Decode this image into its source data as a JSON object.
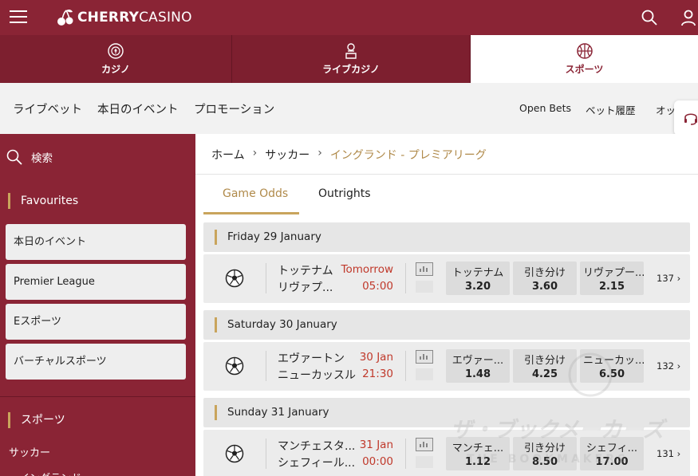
{
  "brand": {
    "logo_text_bold": "CHERRY",
    "logo_text_rest": "CASINO",
    "accent": "#8a2435",
    "gold": "#c9a45c"
  },
  "categories": [
    {
      "label": "カジノ",
      "icon": "casino-chip-icon"
    },
    {
      "label": "ライブカジノ",
      "icon": "live-dealer-icon"
    },
    {
      "label": "スポーツ",
      "icon": "basketball-icon",
      "active": true
    }
  ],
  "subnav": {
    "items": [
      "ライブベット",
      "本日のイベント",
      "プロモーション"
    ],
    "right": [
      "Open Bets",
      "ベット履歴",
      "オッ"
    ]
  },
  "sidebar": {
    "search_label": "検索",
    "favourites_heading": "Favourites",
    "favourites": [
      "本日のイベント",
      "Premier League",
      "Eスポーツ",
      "バーチャルスポーツ"
    ],
    "sports_heading": "スポーツ",
    "sports": [
      "サッカー",
      "イングランド"
    ]
  },
  "breadcrumb": {
    "home": "ホーム",
    "sport": "サッカー",
    "current": "イングランド - プレミアリーグ"
  },
  "odds_tabs": [
    {
      "label": "Game Odds",
      "active": true
    },
    {
      "label": "Outrights",
      "active": false
    }
  ],
  "days": [
    {
      "date": "Friday 29 January",
      "match": {
        "home": "トッテナム",
        "away": "リヴァプ...",
        "time1": "Tomorrow",
        "time2": "05:00",
        "odds": [
          {
            "label": "トッテナム",
            "value": "3.20"
          },
          {
            "label": "引き分け",
            "value": "3.60"
          },
          {
            "label": "リヴァプー...",
            "value": "2.15"
          }
        ],
        "more": "137"
      }
    },
    {
      "date": "Saturday 30 January",
      "match": {
        "home": "エヴァートン",
        "away": "ニューカッスル",
        "time1": "30 Jan",
        "time2": "21:30",
        "odds": [
          {
            "label": "エヴァー...",
            "value": "1.48"
          },
          {
            "label": "引き分け",
            "value": "4.25"
          },
          {
            "label": "ニューカッ...",
            "value": "6.50"
          }
        ],
        "more": "132"
      }
    },
    {
      "date": "Sunday 31 January",
      "match": {
        "home": "マンチェスタ...",
        "away": "シェフィール...",
        "time1": "31 Jan",
        "time2": "00:00",
        "odds": [
          {
            "label": "マンチェ...",
            "value": "1.12"
          },
          {
            "label": "引き分け",
            "value": "8.50"
          },
          {
            "label": "シェフィ...",
            "value": "17.00"
          }
        ],
        "more": "131"
      }
    }
  ],
  "watermark": {
    "text": "ザ・ブックメーカーズ",
    "sub": "THE BOOKMAKERS"
  }
}
